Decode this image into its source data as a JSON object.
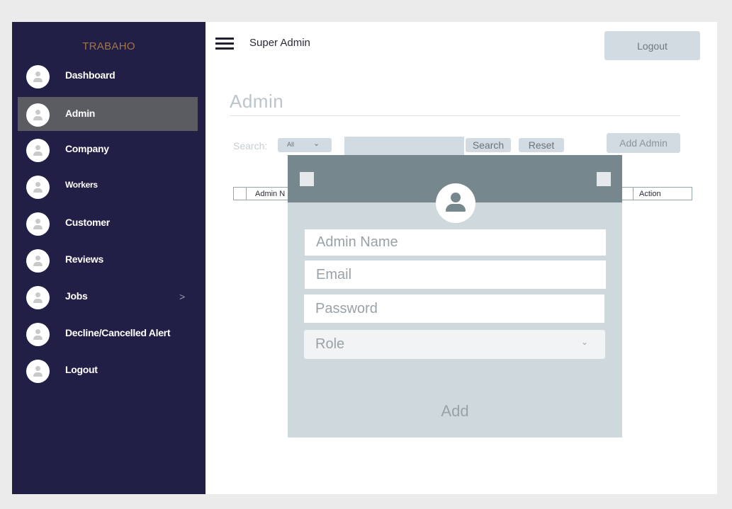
{
  "sidebar": {
    "brand": "TRABAHO",
    "items": [
      {
        "label": "Dashboard"
      },
      {
        "label": "Admin"
      },
      {
        "label": "Company"
      },
      {
        "label": "Workers"
      },
      {
        "label": "Customer"
      },
      {
        "label": "Reviews"
      },
      {
        "label": "Jobs",
        "chevron": ">"
      },
      {
        "label": "Decline/Cancelled Alert"
      },
      {
        "label": "Logout"
      }
    ]
  },
  "topbar": {
    "title": "Super Admin",
    "logout_label": "Logout"
  },
  "page": {
    "title": "Admin",
    "search_label": "Search:",
    "filter_value": "All",
    "search_button": "Search",
    "reset_button": "Reset",
    "add_admin_button": "Add Admin"
  },
  "table": {
    "columns": [
      "Admin N",
      "Action"
    ]
  },
  "modal": {
    "admin_name_placeholder": "Admin Name",
    "email_placeholder": "Email",
    "password_placeholder": "Password",
    "role_value": "Role",
    "add_button": "Add"
  },
  "colors": {
    "sidebar_bg": "#211f45",
    "brand": "#a3754d",
    "active_item": "#5b5b62",
    "modal_header": "#77878e",
    "modal_bg": "#cfd8dd"
  }
}
